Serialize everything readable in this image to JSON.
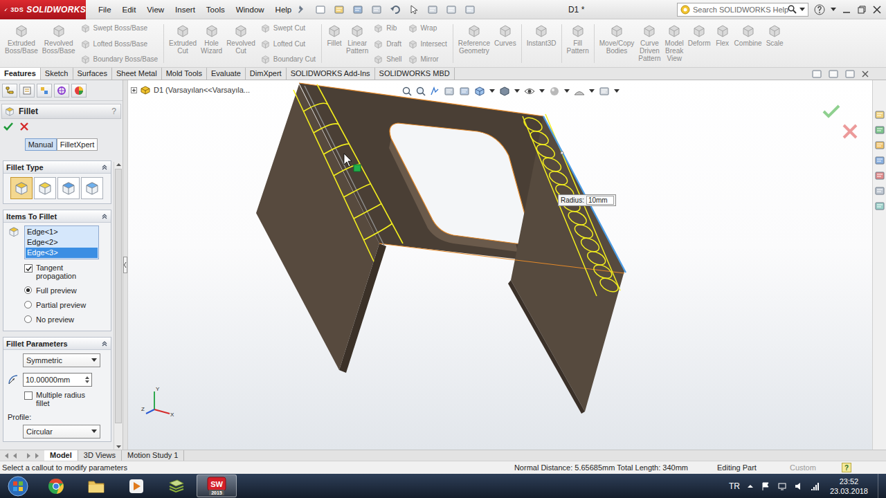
{
  "app": {
    "logo_mark": "3DS",
    "logo": "SOLIDWORKS",
    "document_title": "D1 *"
  },
  "menu": [
    "File",
    "Edit",
    "View",
    "Insert",
    "Tools",
    "Window",
    "Help"
  ],
  "search": {
    "placeholder": "Search SOLIDWORKS Help"
  },
  "ribbon": [
    {
      "items": [
        {
          "kind": "large",
          "label": "Extruded Boss/Base",
          "disabled": true
        },
        {
          "kind": "large",
          "label": "Revolved Boss/Base",
          "disabled": true
        },
        {
          "kind": "stack",
          "entries": [
            {
              "label": "Swept Boss/Base",
              "disabled": true
            },
            {
              "label": "Lofted Boss/Base",
              "disabled": true
            },
            {
              "label": "Boundary Boss/Base",
              "disabled": true
            }
          ]
        }
      ]
    },
    {
      "items": [
        {
          "kind": "large",
          "label": "Extruded Cut",
          "disabled": true
        },
        {
          "kind": "large",
          "label": "Hole Wizard",
          "disabled": true
        },
        {
          "kind": "large",
          "label": "Revolved Cut",
          "disabled": true
        },
        {
          "kind": "stack",
          "entries": [
            {
              "label": "Swept Cut",
              "disabled": true
            },
            {
              "label": "Lofted Cut",
              "disabled": true
            },
            {
              "label": "Boundary Cut",
              "disabled": true
            }
          ]
        }
      ]
    },
    {
      "items": [
        {
          "kind": "large",
          "label": "Fillet",
          "disabled": true
        },
        {
          "kind": "large",
          "label": "Linear Pattern",
          "disabled": true
        },
        {
          "kind": "stack",
          "entries": [
            {
              "label": "Rib",
              "disabled": true
            },
            {
              "label": "Draft",
              "disabled": true
            },
            {
              "label": "Shell",
              "disabled": true
            }
          ]
        },
        {
          "kind": "stack",
          "entries": [
            {
              "label": "Wrap",
              "disabled": true
            },
            {
              "label": "Intersect",
              "disabled": true
            },
            {
              "label": "Mirror",
              "disabled": true
            }
          ]
        }
      ]
    },
    {
      "items": [
        {
          "kind": "large",
          "label": "Reference Geometry",
          "disabled": true
        },
        {
          "kind": "large",
          "label": "Curves",
          "disabled": true
        }
      ]
    },
    {
      "items": [
        {
          "kind": "large",
          "label": "Instant3D",
          "disabled": true
        }
      ]
    },
    {
      "items": [
        {
          "kind": "large",
          "label": "Fill Pattern",
          "disabled": true
        }
      ]
    },
    {
      "items": [
        {
          "kind": "large",
          "label": "Move/Copy Bodies",
          "disabled": true
        },
        {
          "kind": "large",
          "label": "Curve Driven Pattern",
          "disabled": true
        },
        {
          "kind": "large",
          "label": "Model Break View",
          "disabled": true
        },
        {
          "kind": "large",
          "label": "Deform",
          "disabled": true
        },
        {
          "kind": "large",
          "label": "Flex",
          "disabled": true
        },
        {
          "kind": "large",
          "label": "Combine",
          "disabled": true
        },
        {
          "kind": "large",
          "label": "Scale",
          "disabled": true
        }
      ]
    }
  ],
  "tabs": [
    {
      "label": "Features",
      "selected": true
    },
    {
      "label": "Sketch",
      "selected": false
    },
    {
      "label": "Surfaces",
      "selected": false
    },
    {
      "label": "Sheet Metal",
      "selected": false
    },
    {
      "label": "Mold Tools",
      "selected": false
    },
    {
      "label": "Evaluate",
      "selected": false
    },
    {
      "label": "DimXpert",
      "selected": false
    },
    {
      "label": "SOLIDWORKS Add-Ins",
      "selected": false
    },
    {
      "label": "SOLIDWORKS MBD",
      "selected": false
    }
  ],
  "tree": {
    "root": "D1  (Varsayılan<<Varsayıla...",
    "expanded": false
  },
  "property_manager": {
    "title": "Fillet",
    "help": "?",
    "modes": [
      {
        "label": "Manual",
        "selected": true
      },
      {
        "label": "FilletXpert",
        "selected": false
      }
    ],
    "fillet_type": {
      "title": "Fillet Type",
      "options": [
        {
          "selected": true
        },
        {
          "selected": false
        },
        {
          "selected": false
        },
        {
          "selected": false
        }
      ]
    },
    "items_to_fillet": {
      "title": "Items To Fillet",
      "edges": [
        {
          "label": "Edge<1>",
          "selected": false
        },
        {
          "label": "Edge<2>",
          "selected": false
        },
        {
          "label": "Edge<3>",
          "selected": true
        }
      ],
      "tangent": {
        "label": "Tangent propagation",
        "checked": true
      },
      "preview": [
        {
          "label": "Full preview",
          "selected": true
        },
        {
          "label": "Partial preview",
          "selected": false
        },
        {
          "label": "No preview",
          "selected": false
        }
      ]
    },
    "parameters": {
      "title": "Fillet Parameters",
      "method": "Symmetric",
      "radius": "10.00000mm",
      "multiple": {
        "label": "Multiple radius fillet",
        "checked": false
      },
      "profile_label": "Profile:",
      "profile": "Circular"
    },
    "scrollbar": {
      "level": 0.93
    }
  },
  "callout": {
    "label": "Radius:",
    "value": "10mm"
  },
  "triad": {
    "x": "X",
    "y": "Y",
    "z": "Z"
  },
  "bottom_tabs": [
    {
      "label": "Model",
      "selected": true
    },
    {
      "label": "3D Views",
      "selected": false
    },
    {
      "label": "Motion Study 1",
      "selected": false
    }
  ],
  "status_bar": {
    "message": "Select a callout to modify parameters",
    "measure": "Normal Distance: 5.65685mm Total Length: 340mm",
    "mode": "Editing Part",
    "units": {
      "label": "Custom",
      "disabled": true
    },
    "help": "?"
  },
  "taskbar": {
    "apps": [
      {
        "kind": "chrome",
        "active": false
      },
      {
        "kind": "explorer",
        "active": false
      },
      {
        "kind": "media",
        "active": false
      },
      {
        "kind": "notes",
        "active": false
      },
      {
        "kind": "solidworks",
        "active": true,
        "logo": "SW",
        "badge": "2015"
      }
    ],
    "language": "TR",
    "time": "23:52",
    "date": "23.03.2018"
  }
}
